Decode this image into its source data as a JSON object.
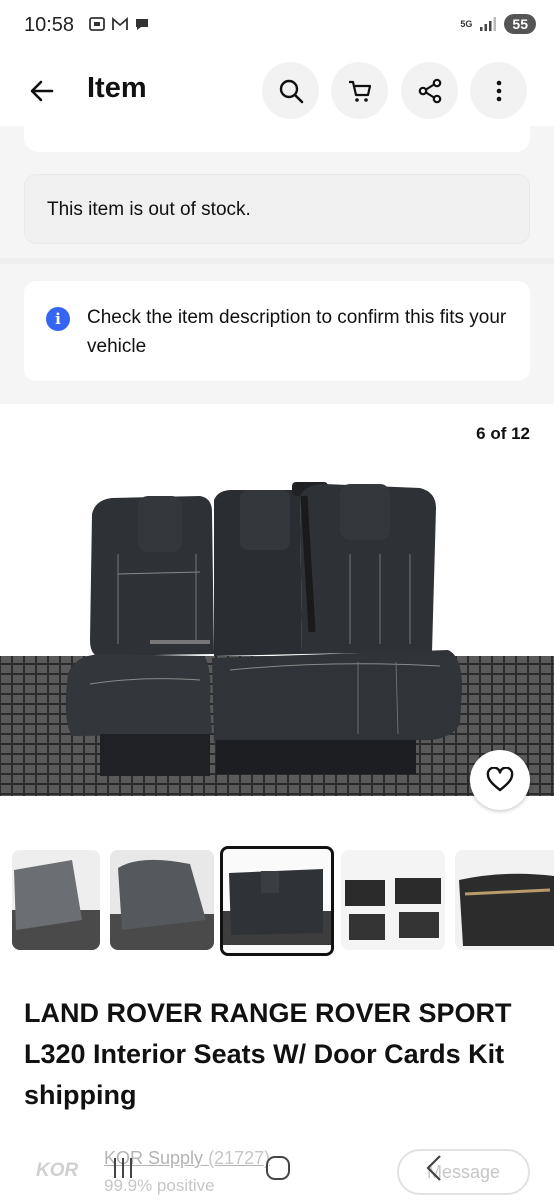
{
  "status_bar": {
    "time": "10:58",
    "network": "5G",
    "battery": "55"
  },
  "header": {
    "title": "Item",
    "icons": [
      "back-arrow-icon",
      "search-icon",
      "cart-icon",
      "share-icon",
      "more-vertical-icon"
    ]
  },
  "notices": {
    "out_of_stock": "This item is out of stock.",
    "fitment": "Check the item description to confirm this fits your vehicle"
  },
  "gallery": {
    "counter": "6 of 12",
    "current_index": 6,
    "total": 12,
    "active_thumbnail": 3,
    "thumbnail_count": 5
  },
  "listing": {
    "title": "LAND ROVER RANGE ROVER SPORT L320 Interior Seats W/ Door Cards Kit shipping"
  },
  "seller": {
    "logo": "KOR",
    "name": "KOR Supply",
    "count": "(21727)",
    "positive": "99.9% positive",
    "message_label": "Message"
  },
  "colors": {
    "accent_blue": "#3665f3",
    "text": "#111111",
    "surface_gray": "#f5f5f5"
  }
}
